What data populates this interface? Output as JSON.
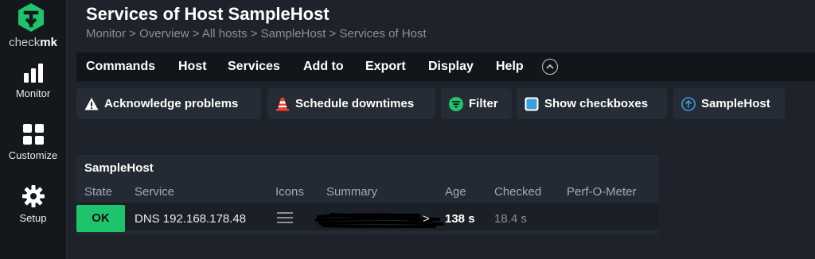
{
  "colors": {
    "accent": "#1ec46c",
    "background": "#1e232b",
    "sidebar": "#14181d",
    "menubar": "#12161b",
    "button": "#262c35"
  },
  "sidebar": {
    "brand_prefix": "check",
    "brand_suffix": "mk",
    "items": [
      {
        "label": "Monitor",
        "icon": "bar-chart-icon"
      },
      {
        "label": "Customize",
        "icon": "grid-icon"
      },
      {
        "label": "Setup",
        "icon": "gear-icon"
      }
    ]
  },
  "header": {
    "title": "Services of Host SampleHost",
    "breadcrumb": "Monitor > Overview > All hosts > SampleHost > Services of Host"
  },
  "menubar": {
    "items": [
      "Commands",
      "Host",
      "Services",
      "Add to",
      "Export",
      "Display",
      "Help"
    ],
    "toggle_icon": "chevron-up-icon"
  },
  "actions": [
    {
      "label": "Acknowledge problems",
      "icon": "warning-icon"
    },
    {
      "label": "Schedule downtimes",
      "icon": "traffic-cone-icon"
    },
    {
      "label": "Filter",
      "icon": "filter-icon"
    },
    {
      "label": "Show checkboxes",
      "icon": "checkbox-icon"
    },
    {
      "label": "SampleHost",
      "icon": "arrow-up-icon"
    }
  ],
  "table": {
    "host": "SampleHost",
    "columns": [
      "State",
      "Service",
      "Icons",
      "Summary",
      "Age",
      "Checked",
      "Perf-O-Meter"
    ],
    "rows": [
      {
        "state": "OK",
        "service": "DNS 192.168.178.48",
        "icons": "menu-icon",
        "summary_suffix": ">",
        "age": "138 s",
        "checked": "18.4 s",
        "perf": ""
      }
    ]
  }
}
